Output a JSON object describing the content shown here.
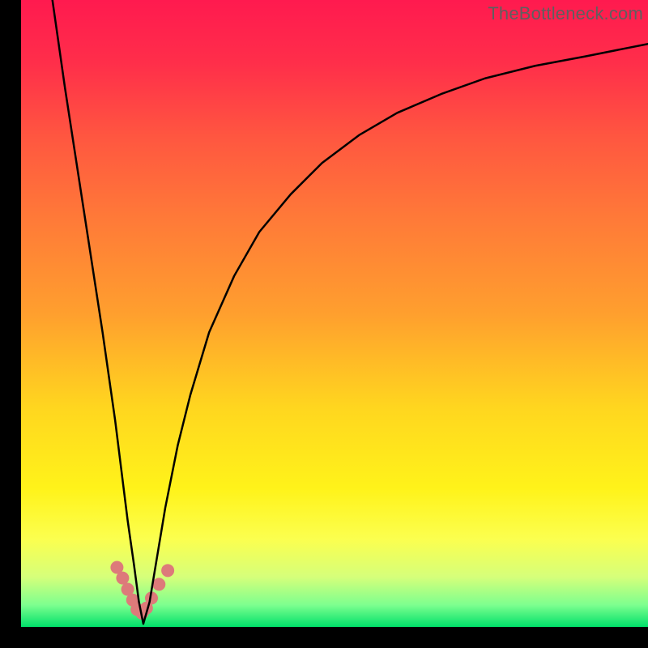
{
  "watermark": "TheBottleneck.com",
  "gradient": {
    "stops": [
      {
        "offset": 0.0,
        "color": "#ff1a4f"
      },
      {
        "offset": 0.1,
        "color": "#ff2e4a"
      },
      {
        "offset": 0.22,
        "color": "#ff5740"
      },
      {
        "offset": 0.35,
        "color": "#ff7a38"
      },
      {
        "offset": 0.5,
        "color": "#ff9f2e"
      },
      {
        "offset": 0.65,
        "color": "#ffd61f"
      },
      {
        "offset": 0.78,
        "color": "#fff31a"
      },
      {
        "offset": 0.86,
        "color": "#fbff4f"
      },
      {
        "offset": 0.92,
        "color": "#d6ff7a"
      },
      {
        "offset": 0.965,
        "color": "#7dff8f"
      },
      {
        "offset": 1.0,
        "color": "#00e06a"
      }
    ]
  },
  "chart_data": {
    "type": "line",
    "title": "",
    "xlabel": "",
    "ylabel": "",
    "xlim": [
      0,
      100
    ],
    "ylim": [
      0,
      100
    ],
    "series": [
      {
        "name": "curve",
        "x": [
          5,
          7,
          9,
          11,
          13,
          15,
          16,
          17,
          18,
          18.8,
          19.5,
          20.5,
          21.5,
          23,
          25,
          27,
          30,
          34,
          38,
          43,
          48,
          54,
          60,
          67,
          74,
          82,
          90,
          100
        ],
        "y": [
          100,
          86,
          73,
          60,
          47,
          33,
          25,
          17,
          10,
          4,
          0.5,
          4,
          10,
          19,
          29,
          37,
          47,
          56,
          63,
          69,
          74,
          78.5,
          82,
          85,
          87.5,
          89.5,
          91,
          93
        ],
        "color": "#000000",
        "width": 2.5
      }
    ],
    "scatter": {
      "name": "markers",
      "x": [
        15.3,
        16.2,
        17.0,
        17.8,
        18.5,
        19.3,
        20.0,
        20.8,
        22.0,
        23.4
      ],
      "y": [
        9.5,
        7.8,
        6.0,
        4.3,
        2.8,
        2.2,
        3.0,
        4.6,
        6.8,
        9.0
      ],
      "color": "#dd7a7a",
      "radius": 8
    }
  }
}
